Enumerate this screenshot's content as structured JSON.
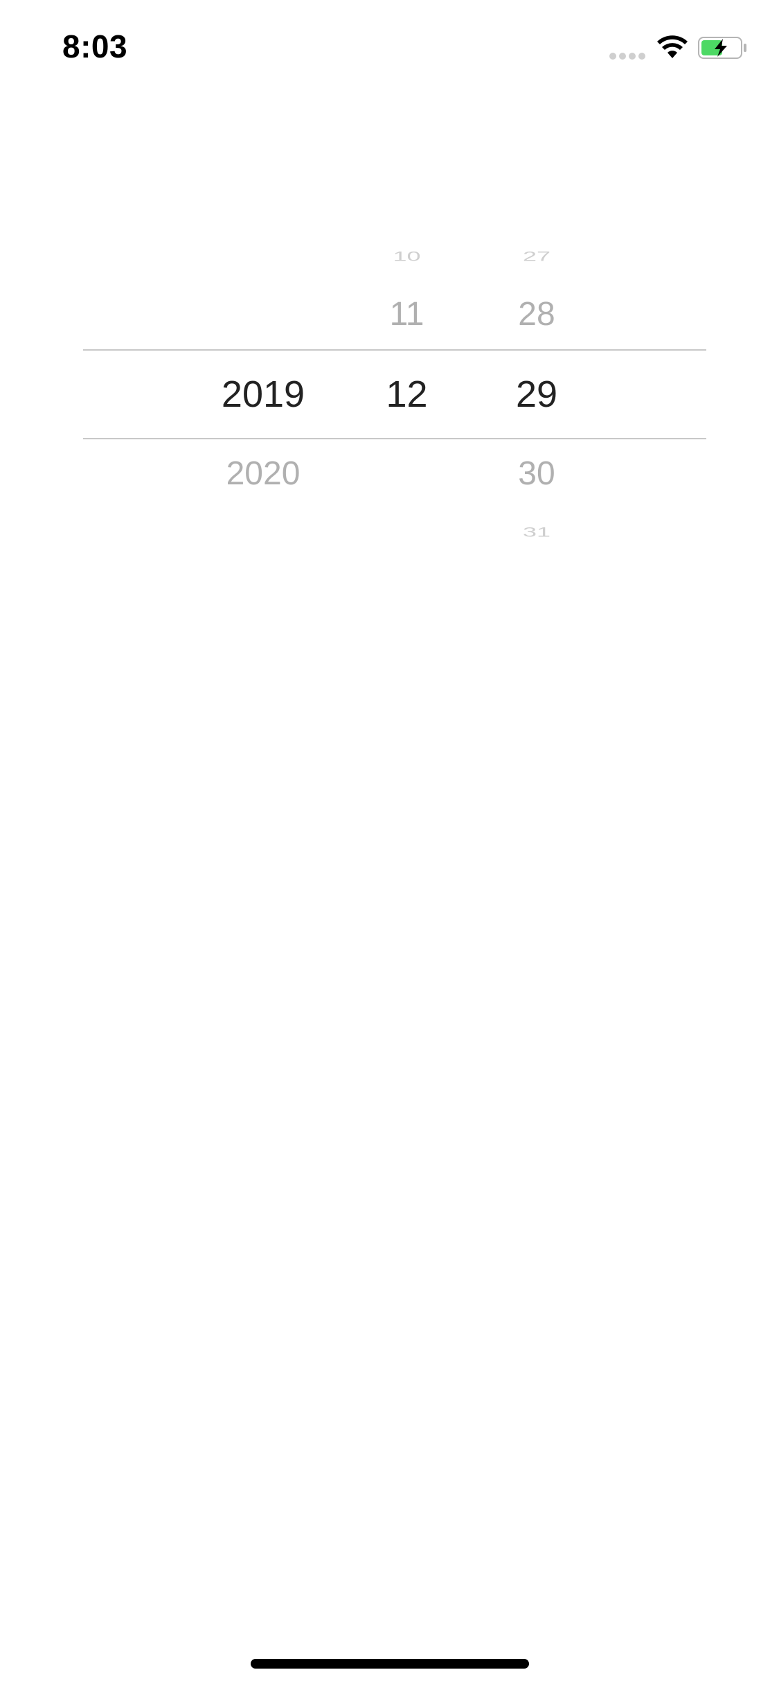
{
  "status_bar": {
    "time": "8:03",
    "icons": [
      "cellular-signal-icon",
      "wifi-icon",
      "battery-charging-icon"
    ],
    "battery_color": "#4cd964"
  },
  "picker": {
    "year": {
      "above": [
        "",
        ""
      ],
      "selected": "2019",
      "below": [
        "2020",
        ""
      ]
    },
    "month": {
      "above": [
        "10",
        "11"
      ],
      "selected": "12",
      "below": [
        "",
        ""
      ]
    },
    "day": {
      "above": [
        "27",
        "28"
      ],
      "selected": "29",
      "below": [
        "30",
        "31"
      ]
    }
  }
}
